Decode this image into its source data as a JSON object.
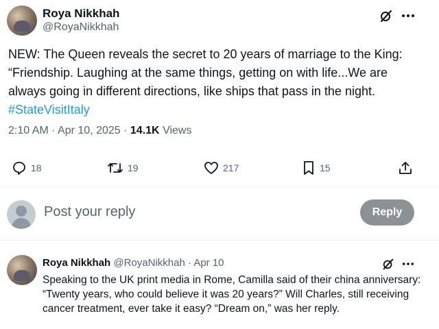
{
  "tweet": {
    "author_name": "Roya Nikkhah",
    "author_handle": "@RoyaNikkhah",
    "text": "NEW: The Queen reveals the secret to 20 years of marriage to the King: “Friendship. Laughing at the same things, getting on with life...We are always going in different directions, like ships that pass in the night.",
    "hashtag": "#StateVisitItaly",
    "time": "2:10 AM",
    "separator": "·",
    "date": "Apr 10, 2025",
    "views_count": "14.1K",
    "views_label": "Views"
  },
  "actions": {
    "replies": "18",
    "reposts": "19",
    "likes": "217",
    "bookmarks": "15"
  },
  "compose": {
    "placeholder": "Post your reply",
    "reply_button": "Reply"
  },
  "reply": {
    "author_name": "Roya Nikkhah",
    "author_handle": "@RoyaNikkhah",
    "separator": "·",
    "date": "Apr 10",
    "text": "Speaking to the UK print media in Rome, Camilla said of their china anniversary: “Twenty years, who could believe it was 20 years?” Will Charles, still receiving cancer treatment, ever take it easy? “Dream on,” was her reply."
  },
  "icons": {
    "grok": "grok-icon",
    "more": "more-icon",
    "reply": "reply-icon",
    "repost": "repost-icon",
    "like": "heart-icon",
    "bookmark": "bookmark-icon",
    "share": "share-icon"
  },
  "colors": {
    "link": "#1d9bf0",
    "secondary_text": "#536471",
    "reply_button_bg": "#8c9196"
  }
}
